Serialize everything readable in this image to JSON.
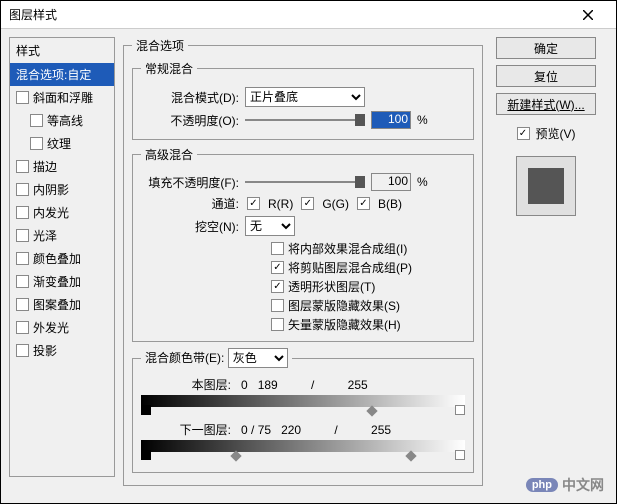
{
  "window": {
    "title": "图层样式"
  },
  "left": {
    "title": "样式",
    "selected": "混合选项:自定",
    "items": [
      {
        "label": "斜面和浮雕",
        "checked": false,
        "indent": false
      },
      {
        "label": "等高线",
        "checked": false,
        "indent": true
      },
      {
        "label": "纹理",
        "checked": false,
        "indent": true
      },
      {
        "label": "描边",
        "checked": false,
        "indent": false
      },
      {
        "label": "内阴影",
        "checked": false,
        "indent": false
      },
      {
        "label": "内发光",
        "checked": false,
        "indent": false
      },
      {
        "label": "光泽",
        "checked": false,
        "indent": false
      },
      {
        "label": "颜色叠加",
        "checked": false,
        "indent": false
      },
      {
        "label": "渐变叠加",
        "checked": false,
        "indent": false
      },
      {
        "label": "图案叠加",
        "checked": false,
        "indent": false
      },
      {
        "label": "外发光",
        "checked": false,
        "indent": false
      },
      {
        "label": "投影",
        "checked": false,
        "indent": false
      }
    ]
  },
  "blendOptions": {
    "groupTitle": "混合选项",
    "general": {
      "groupTitle": "常规混合",
      "blendModeLabel": "混合模式(D):",
      "blendMode": "正片叠底",
      "opacityLabel": "不透明度(O):",
      "opacity": "100",
      "pct": "%"
    },
    "advanced": {
      "groupTitle": "高级混合",
      "fillLabel": "填充不透明度(F):",
      "fill": "100",
      "pct": "%",
      "channelLabel": "通道:",
      "channels": {
        "r": "R(R)",
        "g": "G(G)",
        "b": "B(B)"
      },
      "knockoutLabel": "挖空(N):",
      "knockout": "无",
      "opts": [
        {
          "label": "将内部效果混合成组(I)",
          "checked": false
        },
        {
          "label": "将剪贴图层混合成组(P)",
          "checked": true
        },
        {
          "label": "透明形状图层(T)",
          "checked": true
        },
        {
          "label": "图层蒙版隐藏效果(S)",
          "checked": false
        },
        {
          "label": "矢量蒙版隐藏效果(H)",
          "checked": false
        }
      ]
    },
    "blendIf": {
      "groupTitle": "混合颜色带(E):",
      "channel": "灰色",
      "thisLayer": {
        "label": "本图层:",
        "low": "0",
        "high1": "189",
        "sep": "/",
        "high2": "255"
      },
      "underLayer": {
        "label": "下一图层:",
        "low1": "0",
        "sep1": "/",
        "low2": "75",
        "high1": "220",
        "sep2": "/",
        "high2": "255"
      }
    }
  },
  "right": {
    "ok": "确定",
    "reset": "复位",
    "newStyle": "新建样式(W)...",
    "preview": "预览(V)"
  },
  "watermark": {
    "badge": "php",
    "text": "中文网"
  }
}
